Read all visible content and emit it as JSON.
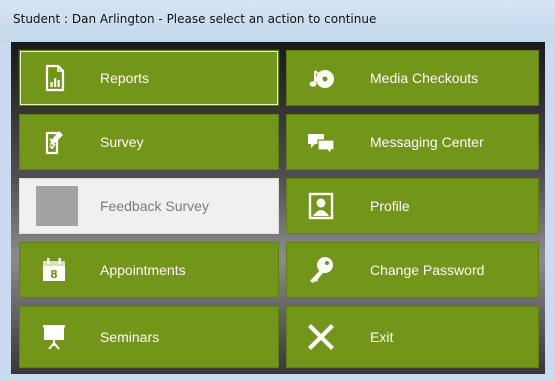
{
  "window": {
    "title": "Student : Dan  Arlington - Please select an action to continue"
  },
  "colors": {
    "tile_green": "#72951a",
    "tile_disabled": "#f0f0f0",
    "titlebar": "#c9dcef"
  },
  "menu": {
    "left": [
      {
        "label": "Reports",
        "icon": "reports-icon",
        "state": "selected"
      },
      {
        "label": "Survey",
        "icon": "survey-icon",
        "state": "normal"
      },
      {
        "label": "Feedback Survey",
        "icon": "placeholder-icon",
        "state": "disabled"
      },
      {
        "label": "Appointments",
        "icon": "calendar-icon",
        "state": "normal"
      },
      {
        "label": "Seminars",
        "icon": "presentation-icon",
        "state": "normal"
      }
    ],
    "right": [
      {
        "label": "Media Checkouts",
        "icon": "music-disc-icon",
        "state": "normal"
      },
      {
        "label": "Messaging Center",
        "icon": "chat-icon",
        "state": "normal"
      },
      {
        "label": "Profile",
        "icon": "profile-icon",
        "state": "normal"
      },
      {
        "label": "Change Password",
        "icon": "key-icon",
        "state": "normal"
      },
      {
        "label": "Exit",
        "icon": "close-icon",
        "state": "normal"
      }
    ]
  }
}
